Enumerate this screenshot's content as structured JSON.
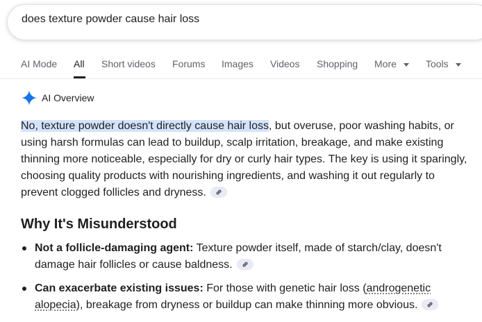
{
  "search": {
    "query": "does texture powder cause hair loss"
  },
  "tabs": [
    {
      "label": "AI Mode"
    },
    {
      "label": "All"
    },
    {
      "label": "Short videos"
    },
    {
      "label": "Forums"
    },
    {
      "label": "Images"
    },
    {
      "label": "Videos"
    },
    {
      "label": "Shopping"
    },
    {
      "label": "More"
    },
    {
      "label": "Tools"
    }
  ],
  "active_tab": "All",
  "overview": {
    "title": "AI Overview",
    "icon": "gemini-sparkle-icon",
    "highlight": "No, texture powder doesn't directly cause hair loss",
    "body": ", but overuse, poor washing habits, or using harsh formulas can lead to buildup, scalp irritation, breakage, and make existing thinning more noticeable, especially for dry or curly hair types. The key is using it sparingly, choosing quality products with nourishing ingredients, and washing it out regularly to prevent clogged follicles and dryness."
  },
  "section": {
    "heading": "Why It's Misunderstood",
    "bullets": [
      {
        "term": "Not a follicle-damaging agent:",
        "text": " Texture powder itself, made of starch/clay, doesn't damage hair follicles or cause baldness."
      },
      {
        "term": "Can exacerbate existing issues:",
        "text_before": " For those with genetic hair loss (",
        "link_term": "androgenetic alopecia",
        "text_after": "), breakage from dryness or buildup can make thinning more obvious."
      }
    ]
  },
  "colors": {
    "highlight": "#d3e3fd",
    "link_chip": "#e8eaf6",
    "sparkle_blue": "#1a73e8"
  }
}
